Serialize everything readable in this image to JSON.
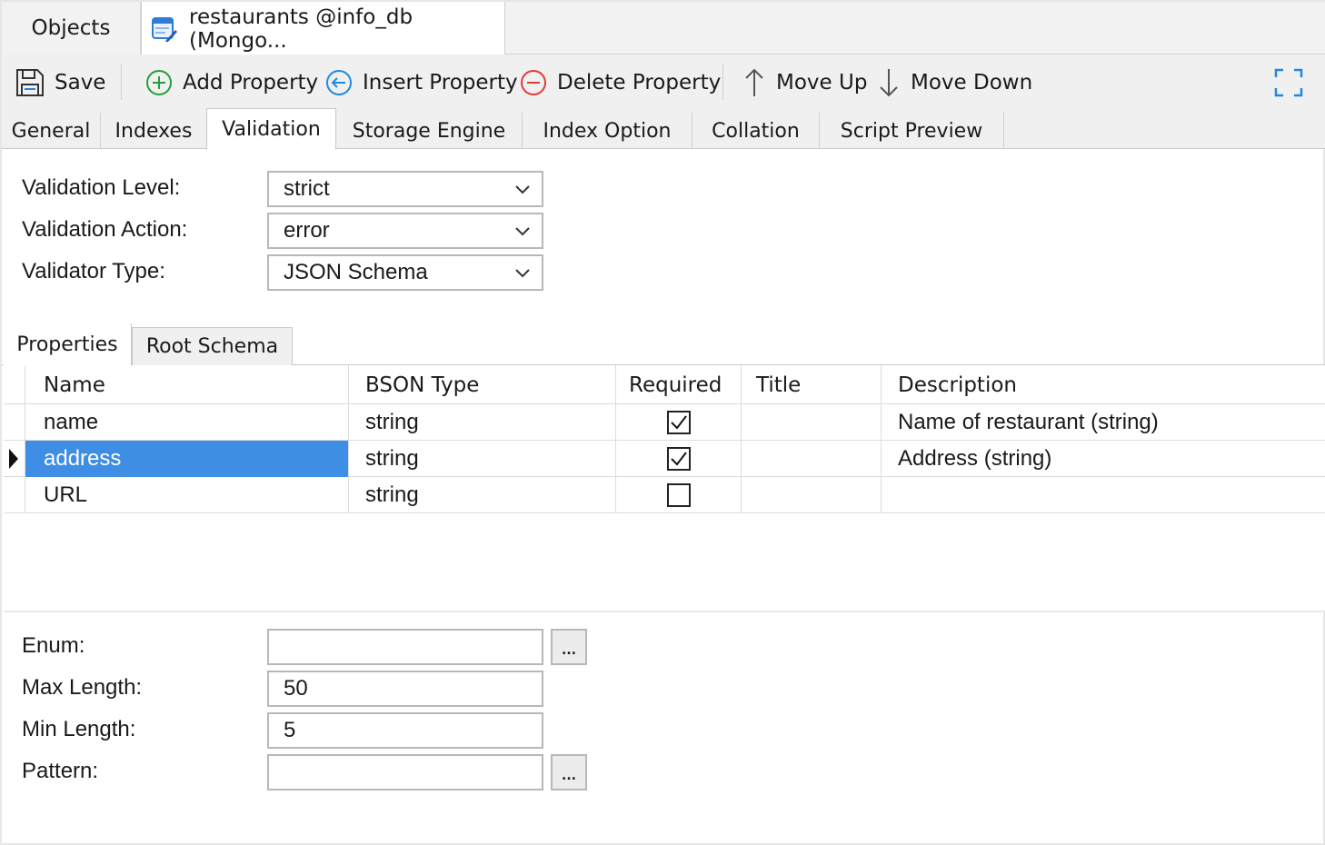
{
  "doc_tabs": {
    "objects": "Objects",
    "active": "restaurants @info_db (Mongo..."
  },
  "toolbar": {
    "save": "Save",
    "add_property": "Add Property",
    "insert_property": "Insert Property",
    "delete_property": "Delete Property",
    "move_up": "Move Up",
    "move_down": "Move Down"
  },
  "sub_tabs": [
    "General",
    "Indexes",
    "Validation",
    "Storage Engine",
    "Index Option",
    "Collation",
    "Script Preview"
  ],
  "active_sub_tab": "Validation",
  "validation": {
    "level_label": "Validation Level:",
    "level_value": "strict",
    "action_label": "Validation Action:",
    "action_value": "error",
    "type_label": "Validator Type:",
    "type_value": "JSON Schema"
  },
  "inner_tabs": [
    "Properties",
    "Root Schema"
  ],
  "grid": {
    "columns": [
      "Name",
      "BSON Type",
      "Required",
      "Title",
      "Description"
    ],
    "rows": [
      {
        "name": "name",
        "bson_type": "string",
        "required": true,
        "title": "",
        "description": "Name of restaurant (string)"
      },
      {
        "name": "address",
        "bson_type": "string",
        "required": true,
        "title": "",
        "description": "Address (string)"
      },
      {
        "name": "URL",
        "bson_type": "string",
        "required": false,
        "title": "",
        "description": ""
      }
    ],
    "selected_row": 1
  },
  "details": {
    "enum_label": "Enum:",
    "enum_value": "",
    "max_length_label": "Max Length:",
    "max_length_value": "50",
    "min_length_label": "Min Length:",
    "min_length_value": "5",
    "pattern_label": "Pattern:",
    "pattern_value": "",
    "browse_label": "..."
  },
  "colors": {
    "selection": "#3d8ee4",
    "add_icon": "#22a03a",
    "insert_icon": "#1e88e5",
    "delete_icon": "#e53935"
  },
  "icons": [
    "collection-icon",
    "save-icon",
    "add-circle-icon",
    "insert-circle-icon",
    "delete-circle-icon",
    "arrow-up-icon",
    "arrow-down-icon",
    "maximize-icon",
    "chevron-down-icon",
    "row-pointer-icon",
    "checkmark-icon"
  ]
}
